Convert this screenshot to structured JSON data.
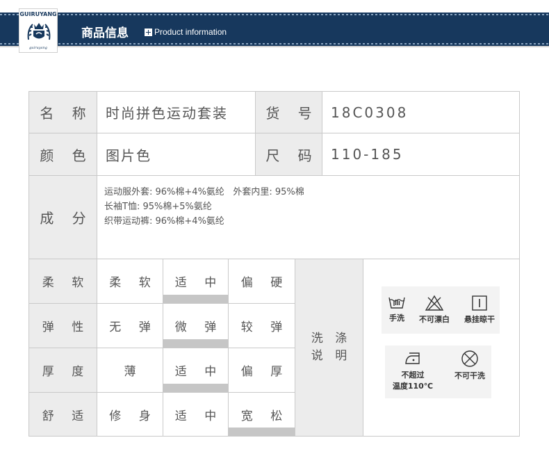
{
  "header": {
    "brand_text": "GUIRUYANG",
    "brand_tagline": "guiruyang",
    "title_cn": "商品信息",
    "title_en": "Product information",
    "colors": {
      "band": "#17385d",
      "label_bg": "#ececec",
      "bar": "#c6c6c6"
    }
  },
  "info": {
    "name_label": "名 称",
    "name_value": "时尚拼色运动套装",
    "sku_label": "货 号",
    "sku_value": "18C0308",
    "color_label": "颜 色",
    "color_value": "图片色",
    "size_label": "尺 码",
    "size_value": "110-185",
    "composition_label": "成 分",
    "composition_lines": [
      "运动服外套: 96%棉+4%氨纶   外套内里: 95%棉",
      "长袖T恤: 95%棉+5%氨纶",
      "织带运动裤: 96%棉+4%氨纶"
    ]
  },
  "grid": {
    "rows": [
      {
        "label": "柔 软",
        "options": [
          "柔 软",
          "适 中",
          "偏 硬"
        ],
        "selected_index": 1
      },
      {
        "label": "弹 性",
        "options": [
          "无 弹",
          "微 弹",
          "较 弹"
        ],
        "selected_index": 1
      },
      {
        "label": "厚 度",
        "options": [
          "薄",
          "适 中",
          "偏 厚"
        ],
        "selected_index": 1
      },
      {
        "label": "舒 适",
        "options": [
          "修 身",
          "适 中",
          "宽 松"
        ],
        "selected_index": 2
      }
    ],
    "wash_label_line1": "洗 涤",
    "wash_label_line2": "说 明"
  },
  "care": {
    "hand_wash": {
      "icon": "hand-wash-icon",
      "label": "手洗"
    },
    "no_bleach": {
      "icon": "no-bleach-icon",
      "label": "不可漂白"
    },
    "hang_dry": {
      "icon": "hang-dry-icon",
      "label": "悬挂晾干"
    },
    "iron": {
      "icon": "iron-icon",
      "label_line1": "不超过",
      "label_line2": "温度110℃"
    },
    "no_dry_clean": {
      "icon": "no-dry-clean-icon",
      "label": "不可干洗"
    }
  }
}
